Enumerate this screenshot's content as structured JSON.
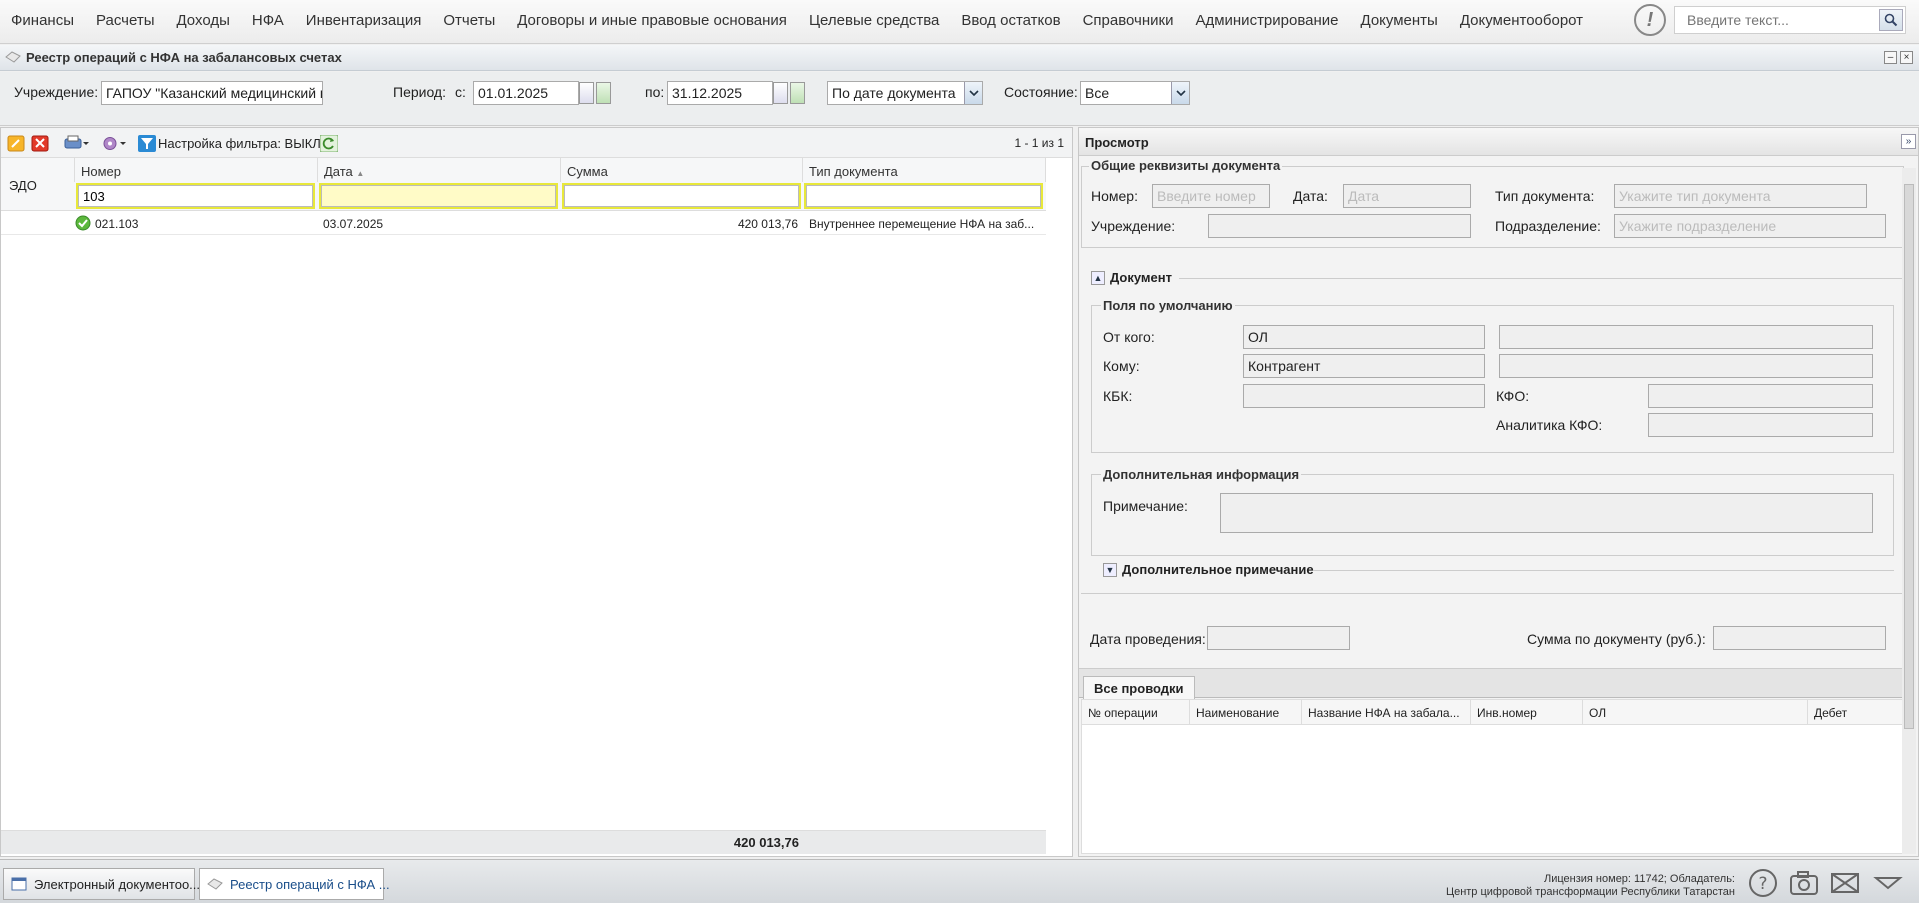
{
  "menu": [
    "Финансы",
    "Расчеты",
    "Доходы",
    "НФА",
    "Инвентаризация",
    "Отчеты",
    "Договоры и иные правовые основания",
    "Целевые средства",
    "Ввод остатков",
    "Справочники",
    "Администрирование",
    "Документы",
    "Документооборот"
  ],
  "search": {
    "placeholder": "Введите текст..."
  },
  "window": {
    "title": "Реестр операций с НФА на забалансовых счетах"
  },
  "filters": {
    "institution_label": "Учреждение:",
    "institution_value": "ГАПОУ \"Казанский медицинский к",
    "period_label": "Период:",
    "from_label": "с:",
    "from_value": "01.01.2025",
    "to_label": "по:",
    "to_value": "31.12.2025",
    "date_mode": "По дате документа",
    "state_label": "Состояние:",
    "state_value": "Все"
  },
  "toolbar": {
    "filter_setting": "Настройка фильтра: ВЫКЛ",
    "paging": "1 - 1 из 1"
  },
  "grid": {
    "edo_label": "ЭДО",
    "columns": [
      "Номер",
      "Дата",
      "Сумма",
      "Тип документа"
    ],
    "filter_number": "103",
    "rows": [
      {
        "number": "021.103",
        "date": "03.07.2025",
        "sum": "420 013,76",
        "type": "Внутреннее перемещение НФА на заб..."
      }
    ],
    "total": "420 013,76"
  },
  "preview": {
    "title": "Просмотр",
    "general_legend": "Общие реквизиты документа",
    "number_label": "Номер:",
    "number_placeholder": "Введите номер",
    "date_label": "Дата:",
    "date_placeholder": "Дата",
    "doctype_label": "Тип документа:",
    "doctype_placeholder": "Укажите тип документа",
    "institution_label": "Учреждение:",
    "division_label": "Подразделение:",
    "division_placeholder": "Укажите подразделение",
    "document_legend": "Документ",
    "defaults_legend": "Поля по умолчанию",
    "from_label": "От кого:",
    "from_value": "ОЛ",
    "to_label": "Кому:",
    "to_value": "Контрагент",
    "kbk_label": "КБК:",
    "kfo_label": "КФО:",
    "kfo_analytics_label": "Аналитика КФО:",
    "extra_info_legend": "Дополнительная информация",
    "note_label": "Примечание:",
    "extra_note_legend": "Дополнительное примечание",
    "posting_date_label": "Дата проведения:",
    "doc_sum_label": "Сумма по документу (руб.):",
    "tab_all_postings": "Все проводки",
    "postings_columns": [
      "№ операции",
      "Наименование",
      "Название НФА на забала...",
      "Инв.номер",
      "ОЛ",
      "Дебет"
    ]
  },
  "taskbar": {
    "task1": "Электронный документоо...",
    "task2": "Реестр операций с НФА ...",
    "license_line1": "Лицензия номер: 11742; Обладатель:",
    "license_line2": "Центр цифровой трансформации Республики Татарстан"
  }
}
